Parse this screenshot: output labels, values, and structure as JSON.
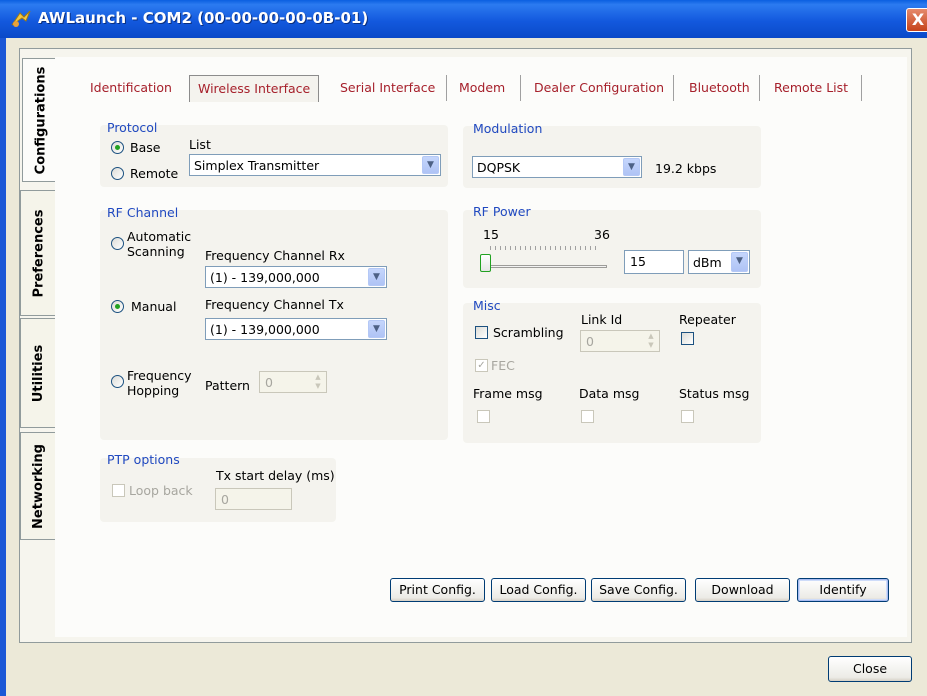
{
  "window": {
    "title": "AWLaunch - COM2  (00-00-00-00-0B-01)",
    "close_glyph": "X"
  },
  "side_tabs": [
    {
      "label": "Configurations",
      "active": true
    },
    {
      "label": "Preferences"
    },
    {
      "label": "Utilities"
    },
    {
      "label": "Networking"
    }
  ],
  "tabs": [
    {
      "label": "Identification"
    },
    {
      "label": "Wireless Interface",
      "active": true
    },
    {
      "label": "Serial Interface"
    },
    {
      "label": "Modem"
    },
    {
      "label": "Dealer Configuration"
    },
    {
      "label": "Bluetooth"
    },
    {
      "label": "Remote List"
    }
  ],
  "protocol": {
    "title": "Protocol",
    "base_label": "Base",
    "remote_label": "Remote",
    "selected": "Base",
    "list_label": "List",
    "list_value": "Simplex Transmitter"
  },
  "modulation": {
    "title": "Modulation",
    "value": "DQPSK",
    "rate": "19.2 kbps"
  },
  "rf_channel": {
    "title": "RF Channel",
    "automatic_label": "Automatic\nScanning",
    "manual_label": "Manual",
    "hopping_label": "Frequency\nHopping",
    "selected": "Manual",
    "rx_label": "Frequency Channel Rx",
    "rx_value": "(1) - 139,000,000",
    "tx_label": "Frequency Channel Tx",
    "tx_value": "(1) - 139,000,000",
    "pattern_label": "Pattern",
    "pattern_value": "0"
  },
  "rf_power": {
    "title": "RF Power",
    "min": "15",
    "max": "36",
    "value": "15",
    "unit": "dBm",
    "level": 0.0
  },
  "misc": {
    "title": "Misc",
    "scrambling_label": "Scrambling",
    "link_id_label": "Link Id",
    "link_id_value": "0",
    "repeater_label": "Repeater",
    "fec_label": "FEC",
    "frame_msg_label": "Frame msg",
    "data_msg_label": "Data msg",
    "status_msg_label": "Status msg"
  },
  "ptp": {
    "title": "PTP options",
    "loopback_label": "Loop back",
    "tx_delay_label": "Tx start delay (ms)",
    "tx_delay_value": "0"
  },
  "buttons": {
    "print": "Print Config.",
    "load": "Load Config.",
    "save": "Save Config.",
    "download": "Download",
    "identify": "Identify",
    "close": "Close"
  },
  "colors": {
    "accent_tab_text": "#A6202B",
    "group_title": "#2049C0",
    "titlebar": "#0A5FE0"
  }
}
